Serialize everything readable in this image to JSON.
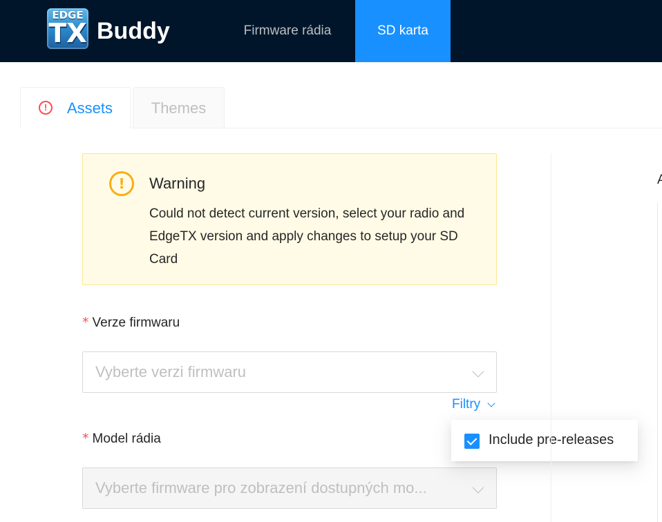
{
  "header": {
    "logo_top": "EDGE",
    "logo_main": "TX",
    "app_name": "Buddy",
    "nav": [
      {
        "label": "Firmware rádia",
        "active": false
      },
      {
        "label": "SD karta",
        "active": true
      }
    ],
    "background_color": "#001529",
    "active_color": "#1890ff"
  },
  "tabs": [
    {
      "label": "Assets",
      "active": true,
      "icon": "exclamation-circle-icon",
      "icon_color": "#ff4d4f"
    },
    {
      "label": "Themes",
      "active": false
    }
  ],
  "alert": {
    "icon": "exclamation-circle-icon",
    "icon_color": "#faad14",
    "title": "Warning",
    "description": "Could not detect current version, select your radio and EdgeTX version and apply changes to setup your SD Card"
  },
  "form": {
    "required_mark": "*",
    "firmware_version": {
      "label": "Verze firmwaru",
      "placeholder": "Vyberte verzi firmwaru",
      "disabled": false
    },
    "filters_link": "Filtry",
    "filters_menu": {
      "include_prereleases_label": "Include pre-releases",
      "include_prereleases_checked": true
    },
    "radio_model": {
      "label": "Model rádia",
      "placeholder": "Vyberte firmware pro zobrazení dostupných mo...",
      "disabled": true
    }
  },
  "right_panel": {
    "partial_heading": "A"
  }
}
